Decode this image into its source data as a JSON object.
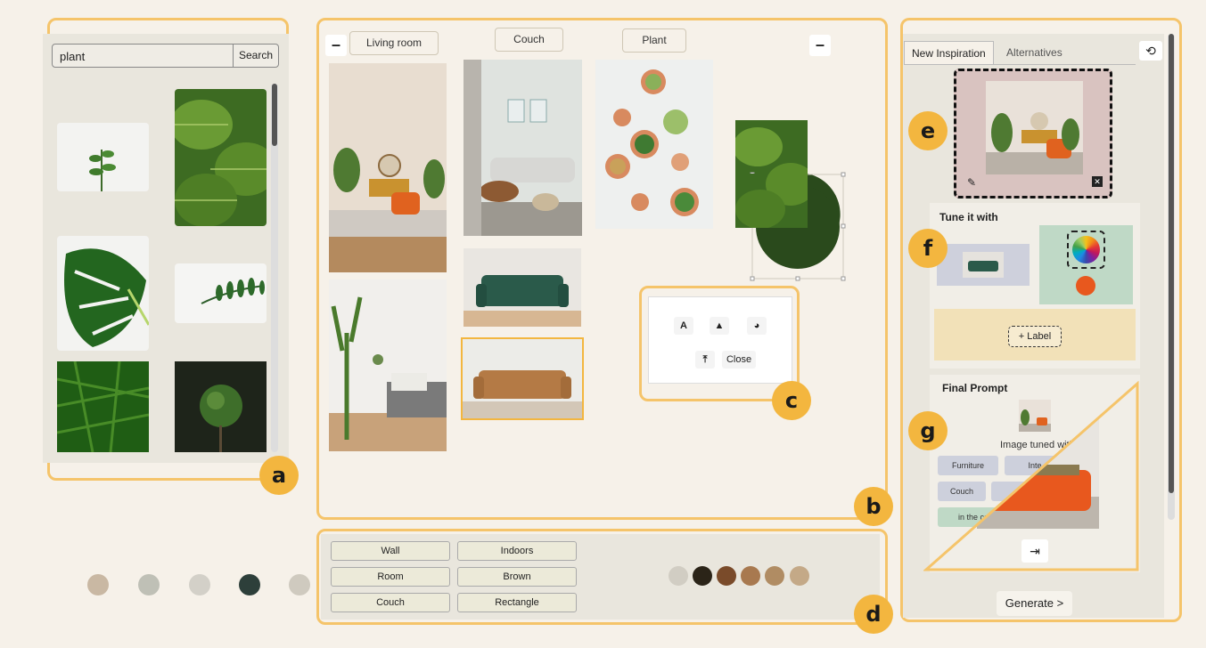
{
  "search": {
    "value": "plant",
    "button_label": "Search"
  },
  "board": {
    "labels": [
      "Living room",
      "Couch",
      "Plant"
    ],
    "minus_symbol": "–",
    "popup": {
      "text_icon": "A",
      "shapes_icon": "shapes-icon",
      "palette_icon": "palette-icon",
      "upload_icon": "upload-icon",
      "close_label": "Close"
    }
  },
  "tags": {
    "col1": [
      "Wall",
      "Room",
      "Couch"
    ],
    "col2": [
      "Indoors",
      "Brown",
      "Rectangle"
    ]
  },
  "palette_swatches": [
    "#d1cdc3",
    "#2b2418",
    "#7a4b2a",
    "#a8794f",
    "#b08c63",
    "#c4a987"
  ],
  "bottom_dots": [
    "#c9b8a3",
    "#bfc0b6",
    "#d3d0c8",
    "#2d3f3a",
    "#cfcabf"
  ],
  "right_panel": {
    "tabs": [
      "New Inspiration",
      "Alternatives"
    ],
    "tune_title": "Tune it with",
    "label_button": "+ Label",
    "final_prompt_title": "Final Prompt",
    "image_tuned_text": "Image tuned with",
    "chips": [
      "Furniture",
      "Inte",
      "Couch",
      "",
      "in the co"
    ],
    "generate_label": "Generate >"
  },
  "badges": [
    "a",
    "b",
    "c",
    "d",
    "e",
    "f",
    "g"
  ],
  "colors": {
    "accent": "#f5c46a",
    "badge": "#f3b63f",
    "dark_green": "#2a4a1c",
    "orange": "#e8581e"
  }
}
